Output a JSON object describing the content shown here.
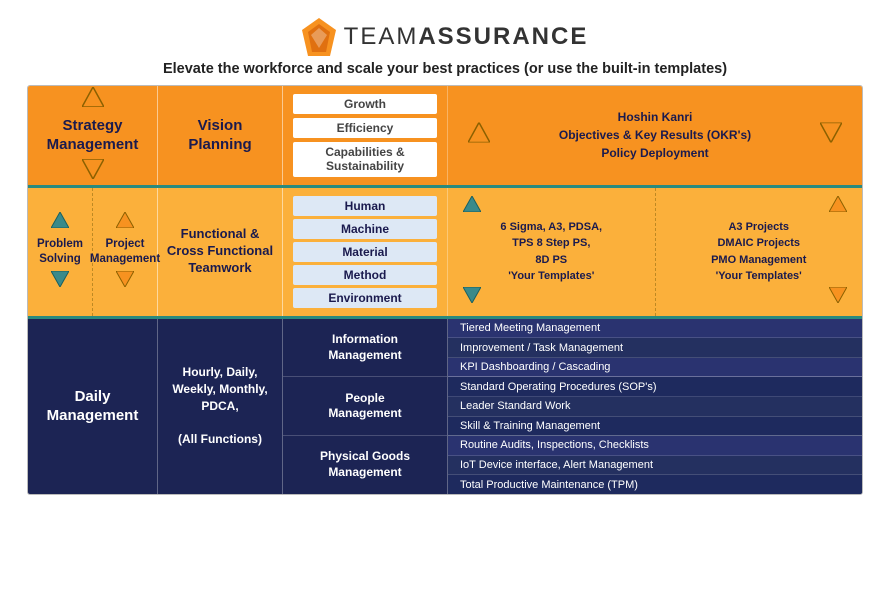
{
  "header": {
    "logo_label": "TEAM",
    "logo_bold": "ASSURANCE",
    "tagline": "Elevate the workforce and scale your best practices (or use the built-in templates)"
  },
  "top_row": {
    "col1": {
      "title": "Strategy\nManagement"
    },
    "col2": {
      "title": "Vision\nPlanning"
    },
    "col3": {
      "items": [
        "Growth",
        "Efficiency",
        "Capabilities &\nSustainability"
      ]
    },
    "col4": {
      "content": "Hoshin Kanri\nObjectives & Key Results (OKR's)\nPolicy Deployment"
    }
  },
  "mid_row": {
    "col1a": {
      "title": "Problem\nSolving"
    },
    "col1b": {
      "title": "Project\nManagement"
    },
    "col2": {
      "title": "Functional &\nCross Functional\nTeamwork"
    },
    "col3": {
      "items": [
        "Human",
        "Machine",
        "Material",
        "Method",
        "Environment"
      ]
    },
    "col4a": {
      "content": "6 Sigma, A3, PDSA,\nTPS 8 Step PS,\n8D PS\n'Your Templates'"
    },
    "col4b": {
      "content": "A3 Projects\nDMAIC Projects\nPMO Management\n'Your Templates'"
    }
  },
  "bot_row": {
    "col1": {
      "title": "Daily\nManagement"
    },
    "col2": {
      "title": "Hourly, Daily,\nWeekly, Monthly,\nPDCA,\n\n(All Functions)"
    },
    "sections": {
      "info_management": {
        "label": "Information\nManagement",
        "items": [
          "Tiered Meeting Management",
          "Improvement / Task Management",
          "KPI Dashboarding / Cascading"
        ]
      },
      "people_management": {
        "label": "People\nManagement",
        "items": [
          "Standard Operating Procedures (SOP's)",
          "Leader Standard Work",
          "Skill & Training Management"
        ]
      },
      "physical_goods": {
        "label": "Physical Goods\nManagement",
        "items": [
          "Routine Audits, Inspections, Checklists",
          "IoT Device interface, Alert Management",
          "Total Productive Maintenance (TPM)"
        ]
      }
    }
  }
}
